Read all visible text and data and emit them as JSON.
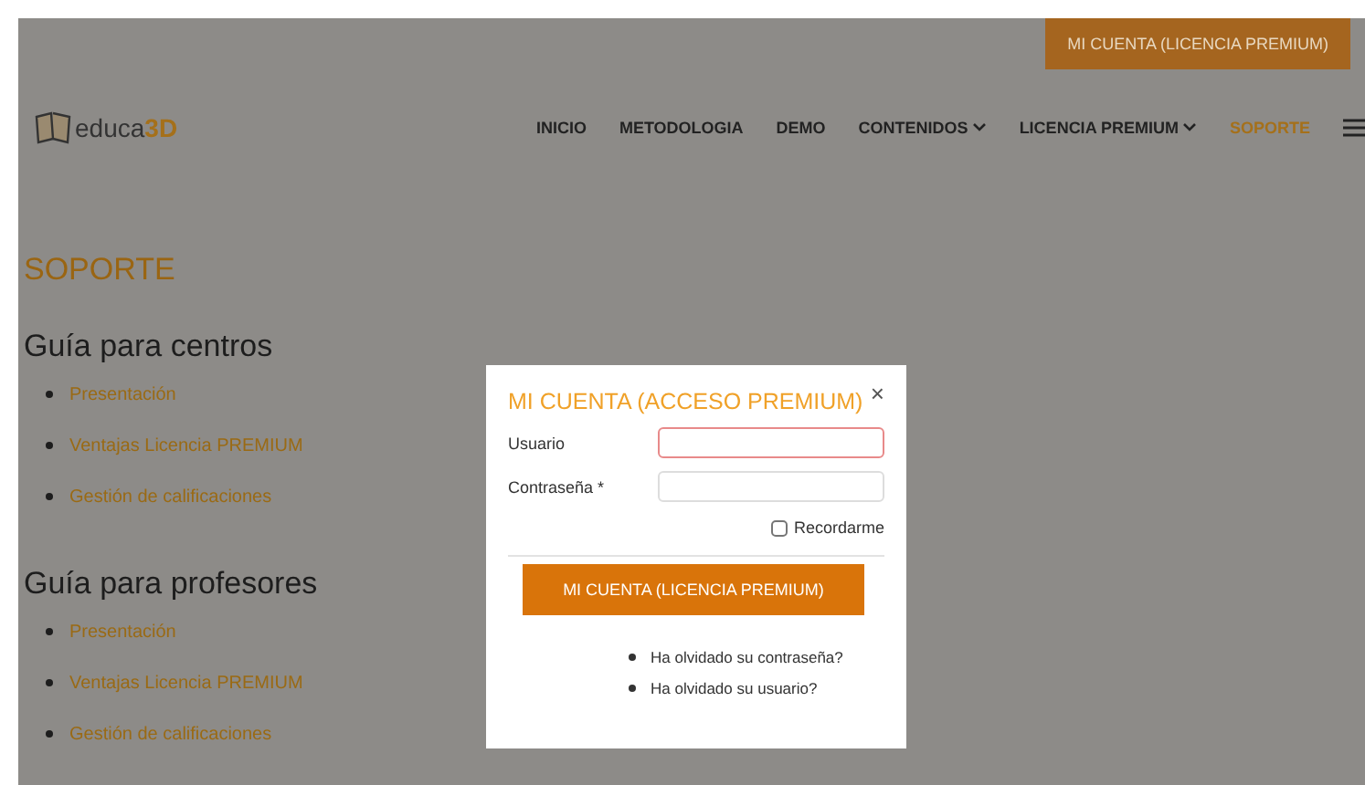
{
  "header_button": "MI CUENTA (LICENCIA PREMIUM)",
  "logo": {
    "text": "educa",
    "accent": "3D"
  },
  "nav": [
    {
      "label": "INICIO",
      "selected": false,
      "dropdown": false
    },
    {
      "label": "METODOLOGIA",
      "selected": false,
      "dropdown": false
    },
    {
      "label": "DEMO",
      "selected": false,
      "dropdown": false
    },
    {
      "label": "CONTENIDOS",
      "selected": false,
      "dropdown": true
    },
    {
      "label": "LICENCIA PREMIUM",
      "selected": false,
      "dropdown": true
    },
    {
      "label": "SOPORTE",
      "selected": true,
      "dropdown": false
    }
  ],
  "page_title": "SOPORTE",
  "sections": [
    {
      "heading": "Guía para centros",
      "links": [
        "Presentación",
        "Ventajas Licencia PREMIUM",
        "Gestión de calificaciones"
      ]
    },
    {
      "heading": "Guía para profesores",
      "links": [
        "Presentación",
        "Ventajas Licencia PREMIUM",
        "Gestión de calificaciones"
      ]
    }
  ],
  "modal": {
    "title": "MI CUENTA (ACCESO PREMIUM)",
    "close": "×",
    "fields": [
      {
        "label": "Usuario",
        "focused": true
      },
      {
        "label": "Contraseña *",
        "focused": false
      }
    ],
    "remember": {
      "label": "Recordarme",
      "checked": false
    },
    "submit": "MI CUENTA (LICENCIA PREMIUM)",
    "links": [
      "Ha olvidado su contraseña?",
      "Ha olvidado su usuario?"
    ]
  }
}
